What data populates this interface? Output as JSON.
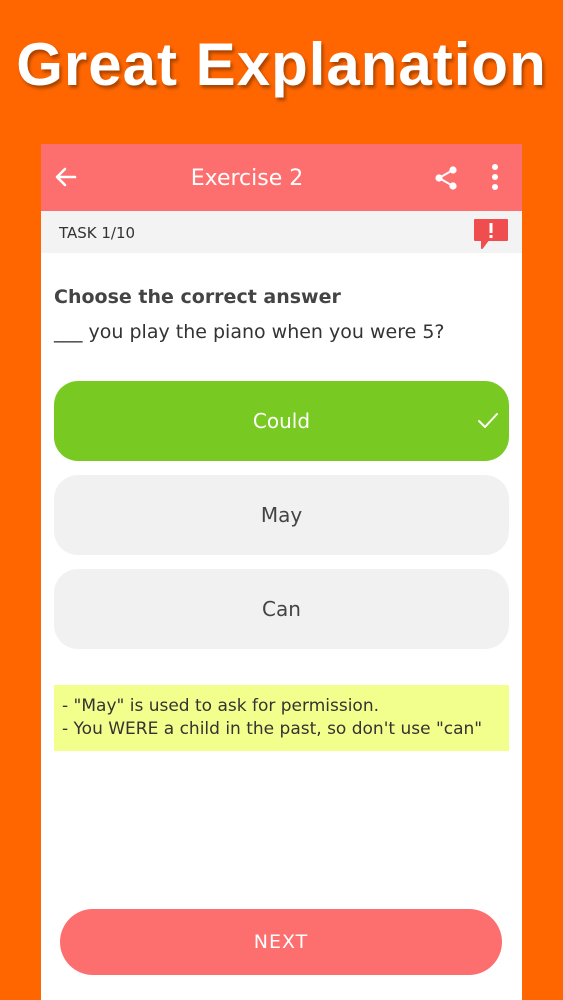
{
  "banner": {
    "text": "Great Explanation"
  },
  "appbar": {
    "title": "Exercise 2",
    "back_icon": "arrow-left-icon",
    "share_icon": "share-icon",
    "more_icon": "more-vert-icon"
  },
  "task": {
    "label": "TASK  1/10",
    "report_icon": "report-exclamation-icon"
  },
  "question": {
    "prompt": "Choose the correct answer",
    "sentence": "___ you play the piano when you were 5?"
  },
  "options": [
    {
      "label": "Could",
      "state": "correct"
    },
    {
      "label": "May",
      "state": "default"
    },
    {
      "label": "Can",
      "state": "default"
    }
  ],
  "explanation": {
    "line1": "- \"May\" is used to ask for permission.",
    "line2": "- You WERE a child in the past, so don't use \"can\""
  },
  "next_button": {
    "label": "NEXT"
  },
  "colors": {
    "background": "#ff6600",
    "accent": "#fd6e6f",
    "correct": "#79c923",
    "option_bg": "#f1f1f1",
    "explanation_bg": "#f3ff8c"
  }
}
